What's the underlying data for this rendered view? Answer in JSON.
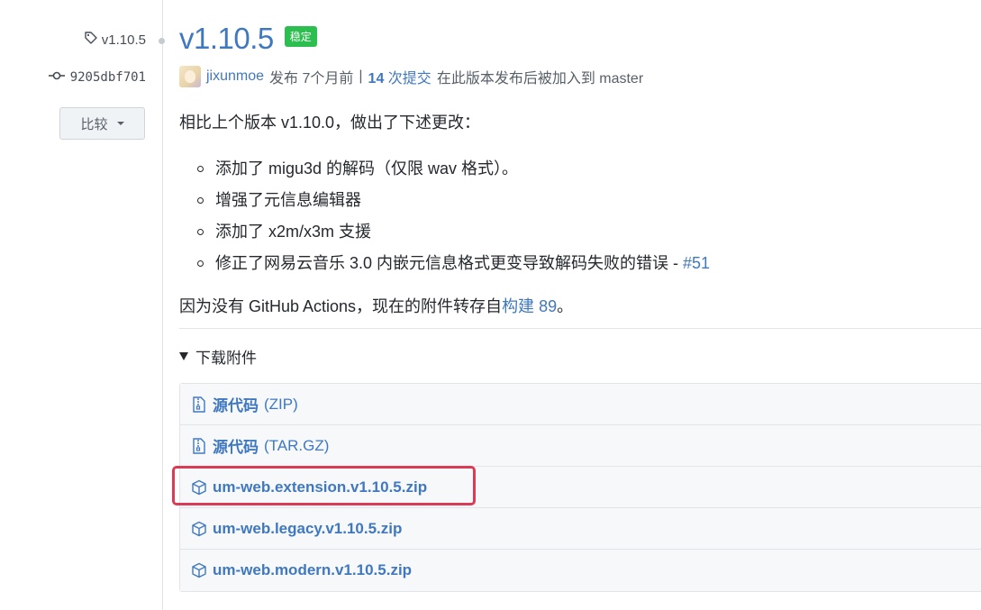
{
  "sidebar": {
    "tag_name": "v1.10.5",
    "commit_sha": "9205dbf701",
    "compare_label": "比较"
  },
  "release": {
    "title": "v1.10.5",
    "badge": "稳定",
    "author": "jixunmoe",
    "published": "发布 7个月前",
    "separator": "|",
    "commits_count": "14",
    "commits_text": "次提交",
    "since_text": "在此版本发布后被加入到 master",
    "intro": "相比上个版本 v1.10.0，做出了下述更改：",
    "changes": [
      "添加了 migu3d 的解码（仅限 wav 格式）。",
      "增强了元信息编辑器",
      "添加了 x2m/x3m 支援"
    ],
    "change4_text": "修正了网易云音乐 3.0 内嵌元信息格式更变导致解码失败的错误 - ",
    "change4_link": "#51",
    "note_prefix": "因为没有 GitHub Actions，现在的附件转存自",
    "note_link": "构建 89",
    "note_suffix": "。"
  },
  "assets": {
    "toggle_label": "下载附件",
    "items": [
      {
        "name": "源代码",
        "ext": "(ZIP)",
        "icon": "file-zip-icon"
      },
      {
        "name": "源代码",
        "ext": "(TAR.GZ)",
        "icon": "file-zip-icon"
      },
      {
        "name": "um-web.extension.v1.10.5.zip",
        "ext": "",
        "icon": "package-icon"
      },
      {
        "name": "um-web.legacy.v1.10.5.zip",
        "ext": "",
        "icon": "package-icon"
      },
      {
        "name": "um-web.modern.v1.10.5.zip",
        "ext": "",
        "icon": "package-icon"
      }
    ]
  },
  "colors": {
    "link": "#4078c0",
    "badge_green": "#2cbe4e",
    "highlight": "#dc3b55"
  }
}
